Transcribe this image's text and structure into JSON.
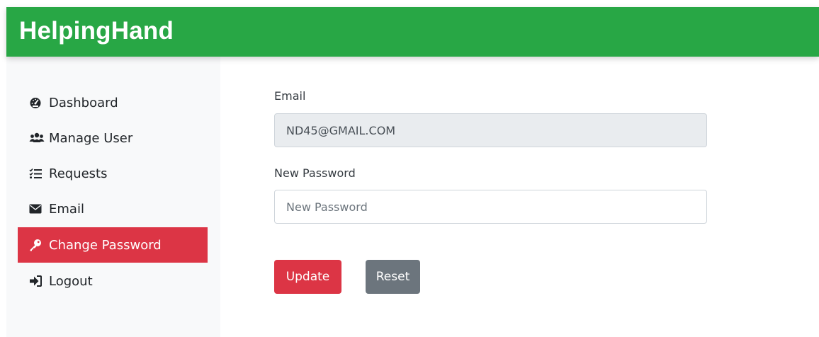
{
  "app": {
    "brand": "HelpingHand"
  },
  "sidebar": {
    "items": [
      {
        "label": "Dashboard",
        "icon": "tachometer-icon"
      },
      {
        "label": "Manage User",
        "icon": "users-icon"
      },
      {
        "label": "Requests",
        "icon": "tasks-icon"
      },
      {
        "label": "Email",
        "icon": "envelope-icon"
      },
      {
        "label": "Change Password",
        "icon": "key-icon",
        "active": true
      },
      {
        "label": "Logout",
        "icon": "sign-out-icon"
      }
    ]
  },
  "form": {
    "email_label": "Email",
    "email_value": "ND45@GMAIL.COM",
    "password_label": "New Password",
    "password_placeholder": "New Password",
    "update_label": "Update",
    "reset_label": "Reset"
  },
  "colors": {
    "navbar": "#28a745",
    "active": "#dc3545",
    "secondary": "#6c757d",
    "sidebar_bg": "#f8f9fa"
  }
}
